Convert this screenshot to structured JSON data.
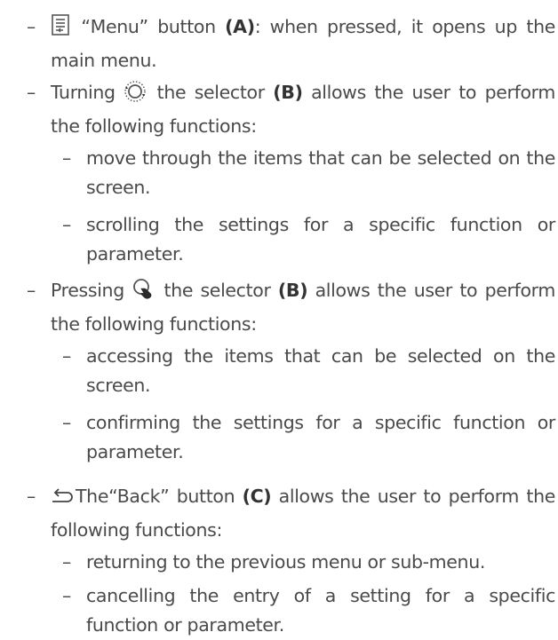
{
  "dash": "–",
  "items": [
    {
      "icon": "menu-list-icon",
      "pre": " “Menu” button ",
      "ref": "(A)",
      "post": ": when pressed, it opens up the main menu."
    },
    {
      "icon": "rotate-selector-icon",
      "pre": "Turning ",
      "mid": " the selector ",
      "ref": "(B)",
      "post": " allows the user to perform the following functions:",
      "subitems": [
        "move through the items that can be selected on the screen.",
        "scrolling the settings for a specific function or parameter."
      ]
    },
    {
      "icon": "press-selector-icon",
      "pre": "Pressing ",
      "mid": " the selector ",
      "ref": "(B)",
      "post": " allows the user to perform the following functions:",
      "subitems": [
        "accessing the items that can be selected on the screen.",
        "confirming the settings for a specific function or parameter."
      ]
    },
    {
      "icon": "back-arrow-icon",
      "pre": "The“Back” button ",
      "ref": "(C)",
      "post": " allows the user to perform the following functions:",
      "subitems": [
        "returning to the previous menu or sub-menu.",
        "cancelling the entry of a setting for a specific function or parameter."
      ]
    }
  ]
}
